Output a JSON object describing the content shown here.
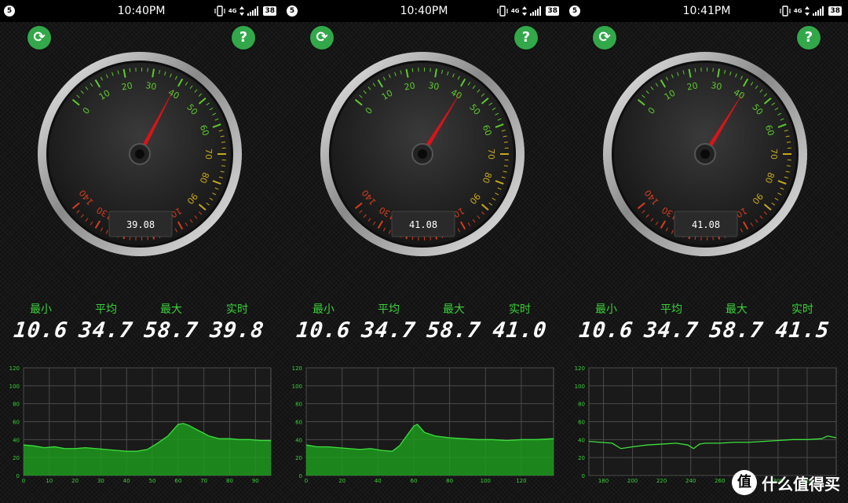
{
  "colors": {
    "accent": "#33a84a",
    "digit": "#ffffff",
    "label": "#3ad23a",
    "grid": "#4a4a4a",
    "fill": "#1d9a1d",
    "needle": "#d8141a"
  },
  "gauge_scale": {
    "min": 0,
    "max": 140,
    "ticks": [
      "0",
      "10",
      "20",
      "30",
      "40",
      "50",
      "60",
      "70",
      "80",
      "90",
      "100",
      "110",
      "120",
      "130",
      "140"
    ]
  },
  "stat_labels": {
    "min": "最小",
    "avg": "平均",
    "max": "最大",
    "live": "实时"
  },
  "panels": [
    {
      "status": {
        "notif": "5",
        "time": "10:40PM",
        "net": "4G",
        "battery": "38"
      },
      "gauge": {
        "readout": "39.08",
        "value": 39.08
      },
      "stats": {
        "min": "10.6",
        "avg": "34.7",
        "max": "58.7",
        "live": "39.8"
      },
      "chart_data": {
        "type": "area",
        "xlim": [
          0,
          96
        ],
        "ylim": [
          0,
          120
        ],
        "x_ticks": [
          "0",
          "10",
          "20",
          "30",
          "40",
          "50",
          "60",
          "70",
          "80",
          "90"
        ],
        "y_ticks": [
          "0",
          "20",
          "40",
          "60",
          "80",
          "100",
          "120"
        ],
        "x": [
          0,
          4,
          8,
          12,
          16,
          20,
          24,
          28,
          32,
          36,
          40,
          44,
          48,
          52,
          56,
          60,
          62,
          64,
          68,
          72,
          76,
          80,
          84,
          88,
          92,
          96
        ],
        "y": [
          34,
          33,
          31,
          32,
          30,
          30,
          31,
          30,
          29,
          28,
          27,
          27,
          29,
          36,
          44,
          57,
          58,
          56,
          50,
          44,
          41,
          41,
          40,
          40,
          39,
          39
        ]
      }
    },
    {
      "status": {
        "notif": "5",
        "time": "10:40PM",
        "net": "4G",
        "battery": "38"
      },
      "gauge": {
        "readout": "41.08",
        "value": 41.08
      },
      "stats": {
        "min": "10.6",
        "avg": "34.7",
        "max": "58.7",
        "live": "41.0"
      },
      "chart_data": {
        "type": "area",
        "xlim": [
          0,
          138
        ],
        "ylim": [
          0,
          120
        ],
        "x_ticks": [
          "0",
          "20",
          "40",
          "60",
          "80",
          "100",
          "120"
        ],
        "y_ticks": [
          "0",
          "20",
          "40",
          "60",
          "80",
          "100",
          "120"
        ],
        "x": [
          0,
          6,
          12,
          18,
          24,
          30,
          36,
          42,
          48,
          52,
          56,
          60,
          62,
          66,
          72,
          80,
          88,
          96,
          104,
          112,
          120,
          128,
          138
        ],
        "y": [
          34,
          32,
          32,
          31,
          30,
          29,
          30,
          28,
          27,
          33,
          44,
          55,
          57,
          48,
          44,
          42,
          41,
          40,
          40,
          39,
          40,
          40,
          41
        ]
      }
    },
    {
      "status": {
        "notif": "5",
        "time": "10:41PM",
        "net": "4G",
        "battery": "38"
      },
      "gauge": {
        "readout": "41.08",
        "value": 41.08
      },
      "stats": {
        "min": "10.6",
        "avg": "34.7",
        "max": "58.7",
        "live": "41.5"
      },
      "chart_data": {
        "type": "line",
        "xlim": [
          170,
          340
        ],
        "ylim": [
          0,
          120
        ],
        "x_ticks": [
          "180",
          "200",
          "220",
          "240",
          "260",
          "280",
          "300",
          "320"
        ],
        "y_ticks": [
          "0",
          "20",
          "40",
          "60",
          "80",
          "100",
          "120"
        ],
        "x": [
          170,
          178,
          186,
          192,
          200,
          210,
          220,
          230,
          238,
          242,
          246,
          250,
          260,
          270,
          280,
          290,
          300,
          310,
          320,
          330,
          334,
          340
        ],
        "y": [
          38,
          37,
          36,
          30,
          32,
          34,
          35,
          36,
          34,
          30,
          35,
          36,
          36,
          37,
          37,
          38,
          39,
          40,
          40,
          41,
          44,
          42
        ]
      }
    }
  ],
  "watermark": {
    "text": "什么值得买",
    "logo": "值"
  }
}
